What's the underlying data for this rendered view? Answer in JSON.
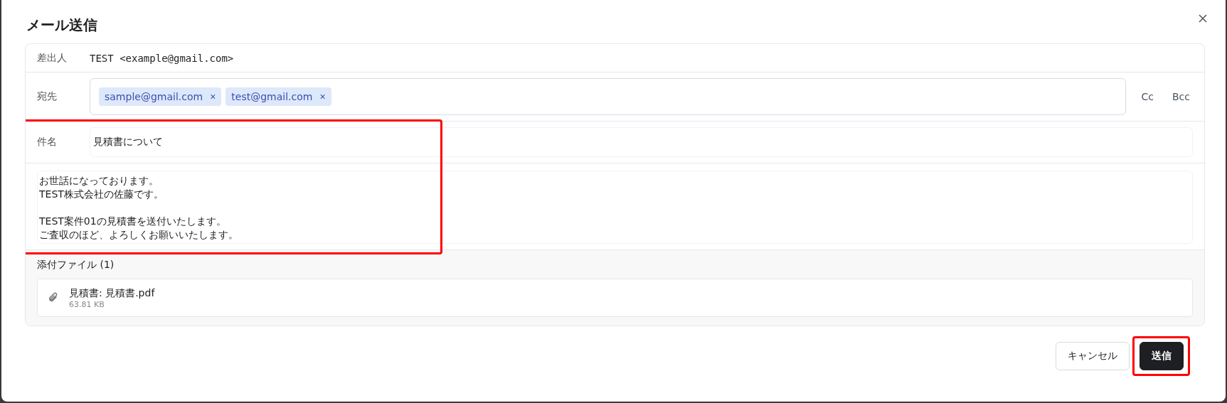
{
  "dialog": {
    "title": "メール送信"
  },
  "from": {
    "label": "差出人",
    "value": "TEST <example@gmail.com>"
  },
  "to": {
    "label": "宛先",
    "recipients": [
      {
        "address": "sample@gmail.com",
        "remove": "×"
      },
      {
        "address": "test@gmail.com",
        "remove": "×"
      }
    ],
    "cc": "Cc",
    "bcc": "Bcc"
  },
  "subject": {
    "label": "件名",
    "value": "見積書について"
  },
  "body": {
    "paragraphs": [
      {
        "lines": [
          "お世話になっております。",
          "TEST株式会社の佐藤です。"
        ]
      },
      {
        "lines": [
          "TEST案件01の見積書を送付いたします。",
          "ご査収のほど、よろしくお願いいたします。"
        ]
      }
    ]
  },
  "message_highlighted": true,
  "attachments": {
    "title": "添付ファイル (1)",
    "files": [
      {
        "name": "見積書: 見積書.pdf",
        "size": "63.81 KB"
      }
    ]
  },
  "buttons": [
    {
      "kind": "secondary",
      "label": "キャンセル"
    },
    {
      "kind": "primary",
      "label": "送信"
    }
  ],
  "send_highlighted": true
}
